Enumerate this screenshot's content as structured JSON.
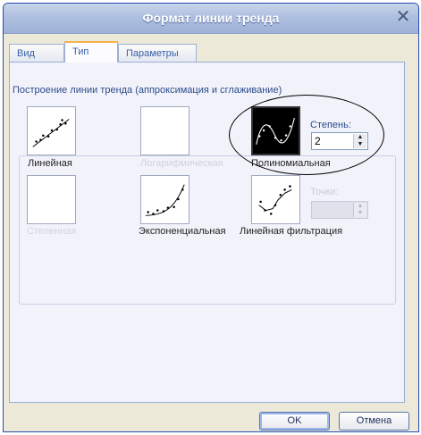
{
  "window": {
    "title": "Формат линии тренда",
    "close_glyph": "✕"
  },
  "tabs": [
    {
      "label": "Вид"
    },
    {
      "label": "Тип",
      "active": true
    },
    {
      "label": "Параметры"
    }
  ],
  "group": {
    "label": "Построение линии тренда (аппроксимация и сглаживание)"
  },
  "trend_types": [
    {
      "label": "Линейная",
      "enabled": true,
      "selected": false
    },
    {
      "label": "Логарифмическая",
      "enabled": false,
      "selected": false
    },
    {
      "label": "Полиномиальная",
      "enabled": true,
      "selected": true
    },
    {
      "label": "Степенная",
      "enabled": false,
      "selected": false
    },
    {
      "label": "Экспоненциальная",
      "enabled": true,
      "selected": false
    },
    {
      "label": "Линейная фильтрация",
      "enabled": true,
      "selected": false
    }
  ],
  "degree": {
    "label": "Степень:",
    "value": "2"
  },
  "points": {
    "label": "Точки:",
    "value": ""
  },
  "buttons": {
    "ok": "OK",
    "cancel": "Отмена"
  },
  "colors": {
    "accent_tab": "#f6b24c",
    "title_bar": "#aebfdf",
    "selected_bg": "#000000"
  }
}
